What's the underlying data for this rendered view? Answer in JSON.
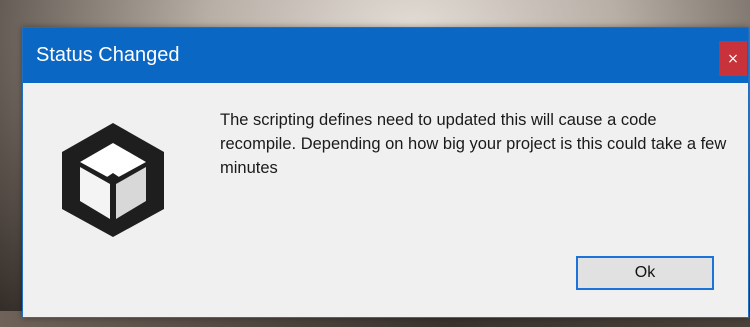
{
  "dialog": {
    "title": "Status Changed",
    "close_label": "×",
    "message": "The scripting defines need to updated this will cause a code recompile. Depending on how big your project is this could take a few minutes",
    "ok_label": "Ok",
    "icon": "unity-logo-icon"
  },
  "colors": {
    "title_bar": "#0a67c4",
    "close_button": "#c8333b",
    "dialog_bg": "#f0f0f0",
    "ok_border": "#1a73d8"
  }
}
